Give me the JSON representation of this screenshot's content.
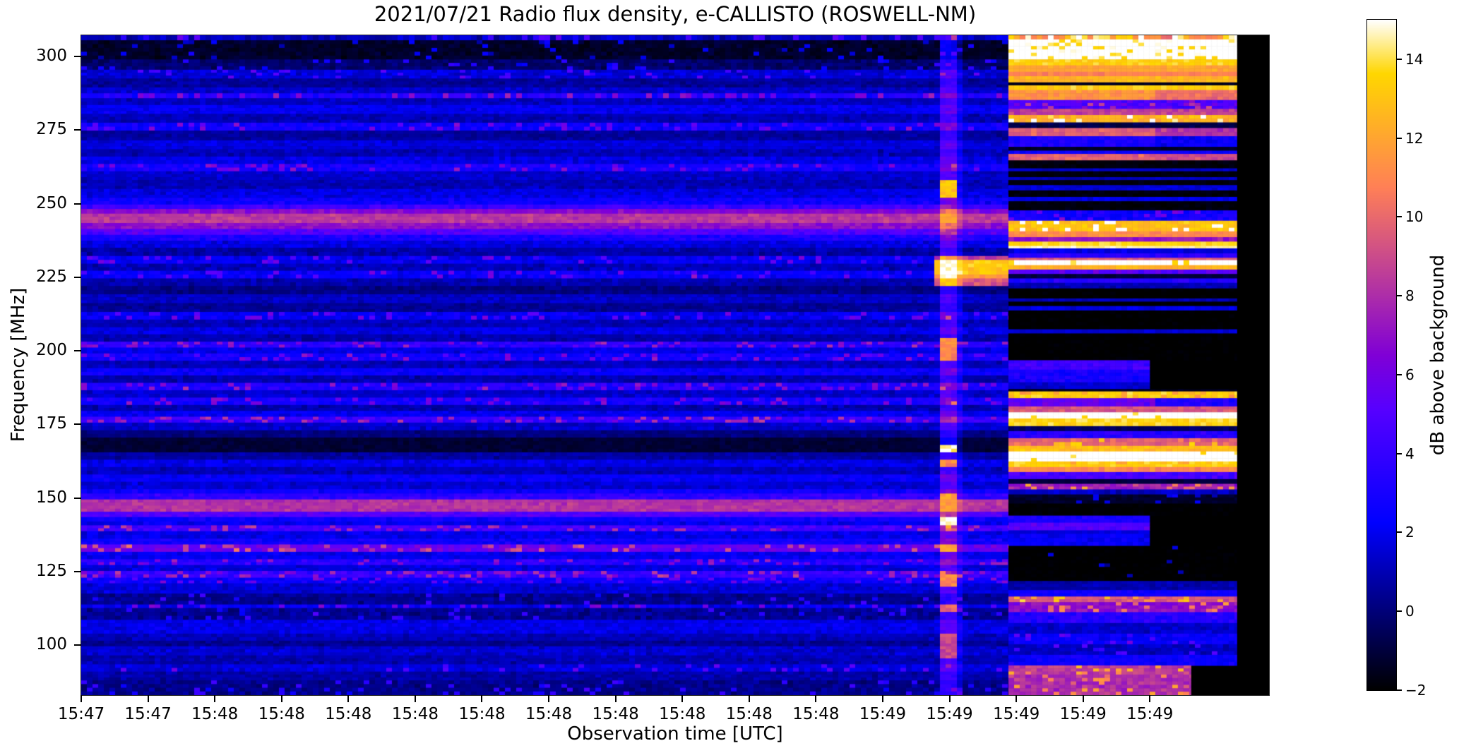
{
  "chart_data": {
    "type": "heatmap",
    "subtype": "radio-spectrogram",
    "title": "2021/07/21  Radio flux density, e-CALLISTO (ROSWELL-NM)",
    "xlabel": "Observation time [UTC]",
    "ylabel": "Frequency [MHz]",
    "grid": false,
    "y_ticks": [
      300,
      275,
      250,
      225,
      200,
      175,
      150,
      125,
      100
    ],
    "y_range": [
      83.0,
      307.2
    ],
    "x_tick_labels": [
      "15:47",
      "15:47",
      "15:48",
      "15:48",
      "15:48",
      "15:48",
      "15:48",
      "15:48",
      "15:48",
      "15:48",
      "15:48",
      "15:48",
      "15:49",
      "15:49",
      "15:49",
      "15:49",
      "15:49"
    ],
    "x_tick_step_frac": 0.05623,
    "colorbar": {
      "label": "dB above background",
      "tick_values": [
        -2,
        0,
        2,
        4,
        6,
        8,
        10,
        12,
        14
      ],
      "tick_labels": [
        "−2",
        "0",
        "2",
        "4",
        "6",
        "8",
        "10",
        "12",
        "14"
      ],
      "range": [
        -2,
        15
      ],
      "colormap": "gnuplot2"
    },
    "regions": {
      "background_x_frac": [
        0.0,
        0.7806
      ],
      "burst_x_frac": [
        0.7253,
        0.7337
      ],
      "burst_halo_x_frac": [
        0.7337,
        0.7408
      ],
      "streak_x_frac": [
        0.7182,
        0.7806
      ],
      "block_x_frac": [
        0.7806,
        0.9732
      ],
      "block_dim_boundary_frac": 0.8997,
      "right_margin_black_frac": [
        0.9732,
        1.0
      ]
    },
    "background_bands": [
      [
        307.2,
        305.5,
        1.2,
        1.0,
        0.15
      ],
      [
        305.5,
        299.0,
        -1.3,
        0.5,
        0.06
      ],
      [
        299.0,
        295.5,
        -0.2,
        0.7,
        0.08
      ],
      [
        295.5,
        292.5,
        1.6,
        0.8,
        0.1
      ],
      [
        292.5,
        289.5,
        0.6,
        0.7,
        0
      ],
      [
        289.5,
        287.5,
        1.4,
        0.7,
        0
      ],
      [
        287.5,
        285.8,
        3.3,
        1.0,
        0.2
      ],
      [
        285.8,
        283.5,
        1.2,
        0.7,
        0
      ],
      [
        283.5,
        280.5,
        2.1,
        0.8,
        0
      ],
      [
        280.5,
        277.5,
        1.0,
        0.7,
        0
      ],
      [
        277.5,
        274.8,
        2.7,
        0.9,
        0.15
      ],
      [
        274.8,
        271.5,
        0.6,
        0.6,
        0
      ],
      [
        271.5,
        268.5,
        1.7,
        0.7,
        0
      ],
      [
        268.5,
        266.0,
        1.0,
        0.7,
        0
      ],
      [
        266.0,
        263.5,
        1.9,
        0.8,
        0
      ],
      [
        263.5,
        261.0,
        3.0,
        0.9,
        0.15
      ],
      [
        261.0,
        258.0,
        1.4,
        0.7,
        0
      ],
      [
        258.0,
        255.0,
        1.0,
        0.7,
        0
      ],
      [
        255.0,
        252.0,
        1.8,
        0.8,
        0
      ],
      [
        252.0,
        249.7,
        2.6,
        0.9,
        0
      ],
      [
        249.7,
        248.2,
        4.2,
        1.0,
        0
      ],
      [
        248.2,
        246.6,
        6.6,
        0.9,
        0
      ],
      [
        246.6,
        243.4,
        8.4,
        0.8,
        0
      ],
      [
        243.4,
        241.4,
        7.0,
        0.9,
        0
      ],
      [
        241.4,
        239.4,
        5.0,
        1.0,
        0
      ],
      [
        239.4,
        237.4,
        3.1,
        0.9,
        0
      ],
      [
        237.4,
        235.0,
        1.8,
        0.8,
        0
      ],
      [
        235.0,
        232.2,
        0.8,
        0.7,
        0
      ],
      [
        232.2,
        229.6,
        2.2,
        0.9,
        0.12
      ],
      [
        229.6,
        227.2,
        1.1,
        0.8,
        0
      ],
      [
        227.2,
        224.6,
        2.4,
        0.9,
        0.12
      ],
      [
        224.6,
        222.0,
        0.9,
        0.7,
        0
      ],
      [
        222.0,
        219.2,
        0.2,
        0.6,
        0
      ],
      [
        219.2,
        216.2,
        1.3,
        0.7,
        0
      ],
      [
        216.2,
        213.2,
        0.5,
        0.6,
        0
      ],
      [
        213.2,
        210.6,
        2.2,
        0.9,
        0.15
      ],
      [
        210.6,
        208.0,
        1.1,
        0.7,
        0
      ],
      [
        208.0,
        205.6,
        1.9,
        0.8,
        0
      ],
      [
        205.6,
        203.1,
        0.9,
        0.7,
        0
      ],
      [
        203.1,
        201.1,
        3.7,
        1.0,
        0.2
      ],
      [
        201.1,
        199.1,
        1.9,
        0.8,
        0
      ],
      [
        199.1,
        196.6,
        2.9,
        0.9,
        0.15
      ],
      [
        196.6,
        194.1,
        1.1,
        0.7,
        0
      ],
      [
        194.1,
        191.6,
        2.5,
        0.8,
        0
      ],
      [
        191.6,
        189.1,
        0.9,
        0.7,
        0
      ],
      [
        189.1,
        186.6,
        3.3,
        1.0,
        0.2
      ],
      [
        186.6,
        184.1,
        1.4,
        0.7,
        0
      ],
      [
        184.1,
        181.6,
        2.9,
        0.9,
        0.15
      ],
      [
        181.6,
        179.6,
        0.9,
        0.7,
        0
      ],
      [
        179.6,
        177.6,
        2.1,
        0.8,
        0
      ],
      [
        177.6,
        175.6,
        4.1,
        1.1,
        0.2
      ],
      [
        175.6,
        173.0,
        1.4,
        0.7,
        0
      ],
      [
        173.0,
        170.5,
        0.1,
        0.5,
        0
      ],
      [
        170.5,
        165.5,
        -1.1,
        0.35,
        0
      ],
      [
        165.5,
        163.0,
        0.7,
        0.6,
        0
      ],
      [
        163.0,
        160.5,
        1.9,
        0.8,
        0
      ],
      [
        160.5,
        158.0,
        1.1,
        0.7,
        0
      ],
      [
        158.0,
        155.5,
        2.3,
        0.8,
        0
      ],
      [
        155.5,
        153.0,
        1.5,
        0.7,
        0
      ],
      [
        153.0,
        151.5,
        2.6,
        0.8,
        0
      ],
      [
        151.5,
        149.5,
        3.8,
        0.9,
        0
      ],
      [
        149.5,
        145.3,
        8.2,
        0.8,
        0
      ],
      [
        145.3,
        143.5,
        5.0,
        0.9,
        0
      ],
      [
        143.5,
        142.0,
        2.6,
        0.8,
        0
      ],
      [
        142.0,
        140.7,
        2.1,
        0.8,
        0
      ],
      [
        140.7,
        138.7,
        4.4,
        1.0,
        0.15
      ],
      [
        138.7,
        136.2,
        1.9,
        0.8,
        0
      ],
      [
        136.2,
        134.2,
        2.7,
        0.9,
        0
      ],
      [
        134.2,
        131.7,
        5.7,
        1.1,
        0.2
      ],
      [
        131.7,
        129.2,
        2.1,
        0.8,
        0
      ],
      [
        129.2,
        127.2,
        3.5,
        1.0,
        0.15
      ],
      [
        127.2,
        125.2,
        1.7,
        0.7,
        0
      ],
      [
        125.2,
        122.9,
        4.1,
        1.1,
        0.2
      ],
      [
        122.9,
        121.0,
        2.6,
        0.9,
        0.15
      ],
      [
        121.0,
        117.5,
        1.6,
        0.8,
        0
      ],
      [
        117.5,
        113.8,
        0.4,
        0.8,
        0.05
      ],
      [
        113.8,
        112.6,
        2.2,
        1.0,
        0.15
      ],
      [
        112.6,
        108.6,
        0.5,
        0.8,
        0.05
      ],
      [
        108.6,
        103.9,
        1.9,
        0.8,
        0
      ],
      [
        103.9,
        101.5,
        1.1,
        0.7,
        0
      ],
      [
        101.5,
        99.6,
        0.4,
        0.6,
        0
      ],
      [
        99.6,
        96.5,
        1.5,
        0.8,
        0
      ],
      [
        96.5,
        93.5,
        0.9,
        0.7,
        0
      ],
      [
        93.5,
        91.0,
        1.7,
        0.8,
        0.1
      ],
      [
        91.0,
        88.0,
        0.8,
        0.7,
        0
      ],
      [
        88.0,
        83.0,
        0.3,
        0.7,
        0.1
      ]
    ],
    "burst": {
      "default_boost_db": 3.5,
      "halo_boost_db": 1.2,
      "hotspots": [
        [
          258,
          252,
          13
        ],
        [
          231,
          224.5,
          15.2
        ],
        [
          204,
          197,
          11
        ],
        [
          168.5,
          165.5,
          14.5
        ],
        [
          163,
          160,
          11
        ],
        [
          152,
          148.5,
          12
        ],
        [
          143.5,
          140.5,
          15.2
        ],
        [
          134.5,
          131.8,
          12
        ],
        [
          124.5,
          120,
          11
        ],
        [
          113.5,
          111,
          10
        ],
        [
          104,
          96,
          9
        ]
      ]
    },
    "streak_bands": [
      [
        232.5,
        230.6,
        8.5
      ],
      [
        230.6,
        226.5,
        13.2
      ],
      [
        226.5,
        224.0,
        11.4
      ],
      [
        224.0,
        221.6,
        9.3
      ]
    ],
    "block_bands": [
      [
        307.2,
        305.8,
        11,
        1.5,
        0.3,
        null,
        null
      ],
      [
        305.8,
        299.0,
        15.2,
        0.4,
        0.12,
        null,
        null
      ],
      [
        299.0,
        297.0,
        13.5,
        0.7,
        0,
        null,
        null
      ],
      [
        297.0,
        294.8,
        12.0,
        0.6,
        0,
        null,
        null
      ],
      [
        294.8,
        293.3,
        10.8,
        0.6,
        0,
        null,
        null
      ],
      [
        293.3,
        291.2,
        12.6,
        0.7,
        0,
        null,
        null
      ],
      [
        291.2,
        290.2,
        -1.5,
        0.3,
        0,
        null,
        null
      ],
      [
        290.2,
        288.6,
        13.4,
        0.7,
        0,
        null,
        null
      ],
      [
        288.6,
        285.2,
        11.4,
        0.8,
        0,
        null,
        10.2
      ],
      [
        285.2,
        282.2,
        5.0,
        1.2,
        0.15,
        null,
        null
      ],
      [
        282.2,
        280.1,
        8.6,
        0.9,
        0,
        null,
        null
      ],
      [
        280.1,
        277.6,
        12.4,
        0.9,
        0.1,
        null,
        null
      ],
      [
        277.6,
        275.7,
        -0.8,
        0.5,
        0,
        null,
        null
      ],
      [
        275.7,
        272.9,
        9.6,
        0.9,
        0,
        null,
        8.2
      ],
      [
        272.9,
        269.3,
        3.1,
        0.8,
        0,
        null,
        2.3
      ],
      [
        269.3,
        268.0,
        -1.4,
        0.3,
        0,
        null,
        null
      ],
      [
        268.0,
        266.9,
        2.6,
        0.6,
        0,
        null,
        null
      ],
      [
        266.9,
        264.7,
        9.8,
        0.9,
        0,
        null,
        9.0
      ],
      [
        264.7,
        262.0,
        -1.8,
        0.25,
        0,
        null,
        null
      ],
      [
        262.0,
        261.0,
        1.3,
        0.5,
        0,
        null,
        null
      ],
      [
        261.0,
        259.0,
        -1.8,
        0.25,
        0,
        null,
        null
      ],
      [
        259.0,
        258.0,
        1.1,
        0.5,
        0,
        null,
        null
      ],
      [
        258.0,
        256.3,
        -1.8,
        0.25,
        0,
        null,
        null
      ],
      [
        256.3,
        254.5,
        1.6,
        0.6,
        0,
        null,
        null
      ],
      [
        254.5,
        252.3,
        -1.8,
        0.25,
        0,
        null,
        null
      ],
      [
        252.3,
        250.8,
        1.9,
        0.6,
        0,
        null,
        null
      ],
      [
        250.8,
        247.7,
        -1.8,
        0.3,
        0,
        null,
        null
      ],
      [
        247.7,
        244.2,
        2.9,
        1.0,
        0.1,
        null,
        null
      ],
      [
        244.2,
        240.6,
        13.0,
        0.8,
        0.15,
        null,
        null
      ],
      [
        240.6,
        238.6,
        11.2,
        0.7,
        0,
        null,
        null
      ],
      [
        238.6,
        237.1,
        7.2,
        0.9,
        0,
        null,
        null
      ],
      [
        237.1,
        235.6,
        13.6,
        0.6,
        0,
        null,
        null
      ],
      [
        235.6,
        234.8,
        14.6,
        0.4,
        0,
        null,
        null
      ],
      [
        234.8,
        233.1,
        1.8,
        0.7,
        0,
        null,
        null
      ],
      [
        233.1,
        231.6,
        3.6,
        0.8,
        0,
        null,
        null
      ],
      [
        231.6,
        230.8,
        9.6,
        0.8,
        0,
        null,
        null
      ],
      [
        230.8,
        229.1,
        15.2,
        0.3,
        0.08,
        null,
        null
      ],
      [
        229.1,
        227.6,
        12.4,
        0.7,
        0,
        null,
        null
      ],
      [
        227.6,
        226.1,
        5.2,
        1.0,
        0,
        null,
        null
      ],
      [
        226.1,
        224.6,
        -1.0,
        0.4,
        0,
        null,
        null
      ],
      [
        224.6,
        223.1,
        3.4,
        0.8,
        0,
        null,
        null
      ],
      [
        223.1,
        221.2,
        1.0,
        0.6,
        0,
        null,
        null
      ],
      [
        221.2,
        217.8,
        -2.0,
        0.2,
        0,
        null,
        null
      ],
      [
        217.8,
        216.7,
        1.0,
        0.5,
        0,
        null,
        null
      ],
      [
        216.7,
        215.2,
        -2.0,
        0.2,
        0,
        null,
        null
      ],
      [
        215.2,
        213.7,
        1.8,
        0.6,
        0,
        null,
        null
      ],
      [
        213.7,
        207.3,
        -2.0,
        0.2,
        0,
        null,
        null
      ],
      [
        207.3,
        205.9,
        1.5,
        0.5,
        0,
        null,
        null
      ],
      [
        205.9,
        196.8,
        -2.0,
        0.2,
        0,
        null,
        null
      ],
      [
        196.8,
        193.6,
        4.4,
        0.9,
        0,
        0.8997,
        null
      ],
      [
        193.6,
        189.3,
        3.0,
        0.8,
        0,
        0.8997,
        null
      ],
      [
        189.3,
        187.0,
        1.4,
        0.6,
        0,
        0.8997,
        null
      ],
      [
        187.0,
        186.2,
        -1.5,
        0.3,
        0,
        null,
        null
      ],
      [
        186.2,
        183.9,
        13.4,
        0.8,
        0.15,
        null,
        null
      ],
      [
        183.9,
        181.1,
        5.6,
        1.0,
        0,
        null,
        3.2
      ],
      [
        181.1,
        179.1,
        9.4,
        0.8,
        0,
        null,
        null
      ],
      [
        179.1,
        177.0,
        15.2,
        0.3,
        0.06,
        null,
        null
      ],
      [
        177.0,
        174.4,
        13.7,
        0.7,
        0,
        null,
        null
      ],
      [
        174.4,
        172.7,
        -0.4,
        0.5,
        0,
        null,
        null
      ],
      [
        172.7,
        170.3,
        3.6,
        0.9,
        0,
        null,
        null
      ],
      [
        170.3,
        167.7,
        9.8,
        1.0,
        0.15,
        null,
        null
      ],
      [
        167.7,
        165.8,
        12.8,
        0.8,
        0,
        null,
        null
      ],
      [
        165.8,
        162.4,
        15.2,
        0.3,
        0.06,
        null,
        null
      ],
      [
        162.4,
        160.5,
        13.4,
        0.7,
        0.1,
        null,
        null
      ],
      [
        160.5,
        158.8,
        11.0,
        0.8,
        0,
        null,
        null
      ],
      [
        158.8,
        156.4,
        4.6,
        1.0,
        0,
        null,
        null
      ],
      [
        156.4,
        154.8,
        -0.9,
        0.4,
        0,
        null,
        null
      ],
      [
        154.8,
        152.9,
        7.6,
        1.1,
        0.15,
        null,
        null
      ],
      [
        152.9,
        151.2,
        1.2,
        0.8,
        0,
        null,
        null
      ],
      [
        151.2,
        148.1,
        -1.3,
        0.4,
        0.08,
        null,
        null
      ],
      [
        148.1,
        144.0,
        -2.0,
        0.2,
        0,
        null,
        null
      ],
      [
        144.0,
        141.6,
        3.1,
        0.7,
        0,
        0.8997,
        null
      ],
      [
        141.6,
        139.0,
        5.1,
        0.8,
        0,
        0.8997,
        null
      ],
      [
        139.0,
        137.8,
        1.6,
        0.5,
        0,
        0.8997,
        null
      ],
      [
        137.8,
        133.7,
        2.2,
        0.7,
        0,
        0.8997,
        null
      ],
      [
        133.7,
        121.8,
        -2.0,
        0.2,
        0.03,
        null,
        null
      ],
      [
        121.8,
        118.7,
        0.9,
        0.6,
        0,
        null,
        null
      ],
      [
        118.7,
        116.5,
        2.6,
        0.7,
        0,
        null,
        null
      ],
      [
        116.5,
        114.6,
        9.4,
        1.0,
        0.15,
        null,
        null
      ],
      [
        114.6,
        111.2,
        7.0,
        1.2,
        0.1,
        null,
        null
      ],
      [
        111.2,
        107.5,
        3.4,
        0.9,
        0,
        null,
        null
      ],
      [
        107.5,
        103.9,
        1.4,
        0.7,
        0,
        null,
        null
      ],
      [
        103.9,
        100.3,
        2.4,
        0.8,
        0.1,
        null,
        null
      ],
      [
        100.3,
        96.7,
        1.2,
        0.7,
        0.1,
        null,
        null
      ],
      [
        96.7,
        93.1,
        2.6,
        0.8,
        0,
        null,
        null
      ],
      [
        93.1,
        90.0,
        8.6,
        1.0,
        0.15,
        0.9345,
        null
      ],
      [
        90.0,
        83.0,
        8.0,
        1.1,
        0.15,
        0.9345,
        null
      ]
    ]
  }
}
